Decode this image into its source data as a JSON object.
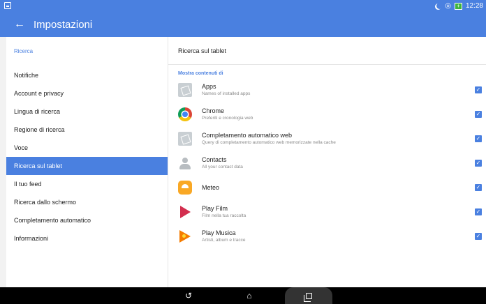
{
  "status_bar": {
    "time": "12:28",
    "battery_icon": "battery-charging-icon",
    "wifi_icon": "wifi-icon",
    "moon_icon": "do-not-disturb-icon"
  },
  "app_bar": {
    "title": "Impostazioni",
    "back_icon": "arrow-back-icon",
    "color": "#4a80e0"
  },
  "sidebar": {
    "header": "Ricerca",
    "items": [
      {
        "label": "Notifiche",
        "active": false
      },
      {
        "label": "Account e privacy",
        "active": false
      },
      {
        "label": "Lingua di ricerca",
        "active": false
      },
      {
        "label": "Regione di ricerca",
        "active": false
      },
      {
        "label": "Voce",
        "active": false
      },
      {
        "label": "Ricerca sul tablet",
        "active": true
      },
      {
        "label": "Il tuo feed",
        "active": false
      },
      {
        "label": "Ricerca dallo schermo",
        "active": false
      },
      {
        "label": "Completamento automatico",
        "active": false
      },
      {
        "label": "Informazioni",
        "active": false
      }
    ]
  },
  "main": {
    "header": "Ricerca sul tablet",
    "section_title": "Mostra contenuti di",
    "rows": [
      {
        "title": "Apps",
        "subtitle": "Names of installed apps",
        "icon": "apps-placeholder-icon",
        "checked": true
      },
      {
        "title": "Chrome",
        "subtitle": "Preferiti e cronologia web",
        "icon": "chrome-icon",
        "checked": true
      },
      {
        "title": "Completamento automatico web",
        "subtitle": "Query di completamento automatico web memorizzate nella cache",
        "icon": "web-autocomplete-placeholder-icon",
        "checked": true
      },
      {
        "title": "Contacts",
        "subtitle": "All your contact data",
        "icon": "contacts-icon",
        "checked": true
      },
      {
        "title": "Meteo",
        "subtitle": "",
        "icon": "meteo-icon",
        "checked": true
      },
      {
        "title": "Play Film",
        "subtitle": "Film nella tua raccolta",
        "icon": "play-film-icon",
        "checked": true
      },
      {
        "title": "Play Musica",
        "subtitle": "Artisti, album e tracce",
        "icon": "play-music-icon",
        "checked": true
      }
    ]
  },
  "nav_bar": {
    "back_icon": "nav-back-icon",
    "home_icon": "nav-home-icon",
    "recents_icon": "nav-recents-icon"
  }
}
